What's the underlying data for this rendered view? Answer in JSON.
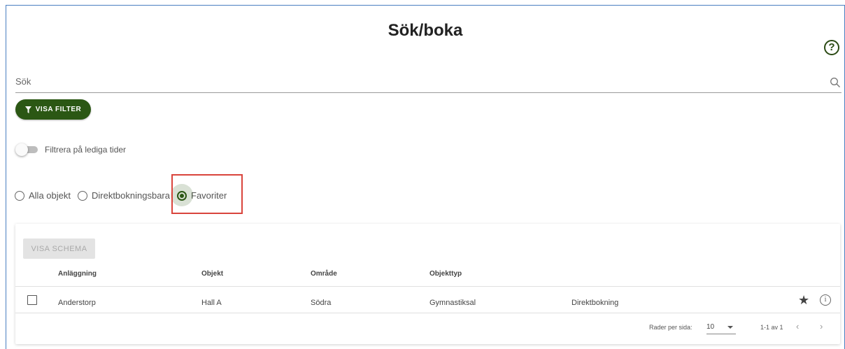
{
  "page": {
    "title": "Sök/boka",
    "help_symbol": "?"
  },
  "search": {
    "placeholder": "Sök"
  },
  "filter_button": {
    "label": "VISA FILTER"
  },
  "toggle": {
    "label": "Filtrera på lediga tider",
    "on": false
  },
  "radios": [
    {
      "label": "Alla objekt",
      "checked": false
    },
    {
      "label": "Direktbokningsbara",
      "checked": false
    },
    {
      "label": "Favoriter",
      "checked": true
    }
  ],
  "table": {
    "schema_button": "VISA SCHEMA",
    "headers": [
      "Anläggning",
      "Objekt",
      "Område",
      "Objekttyp"
    ],
    "rows": [
      {
        "anlaggning": "Anderstorp",
        "objekt": "Hall A",
        "omrade": "Södra",
        "objekttyp": "Gymnastiksal",
        "bokning": "Direktbokning"
      }
    ],
    "footer": {
      "rows_per_page_label": "Rader per sida:",
      "rows_per_page": "10",
      "range": "1-1 av 1",
      "prev": "‹",
      "next": "›"
    }
  },
  "colors": {
    "accent": "#2b5714",
    "highlight": "#d9443c"
  },
  "icons": {
    "search": "search-icon",
    "filter": "filter-icon",
    "help": "help-icon",
    "star": "star-icon",
    "info": "info-icon"
  }
}
